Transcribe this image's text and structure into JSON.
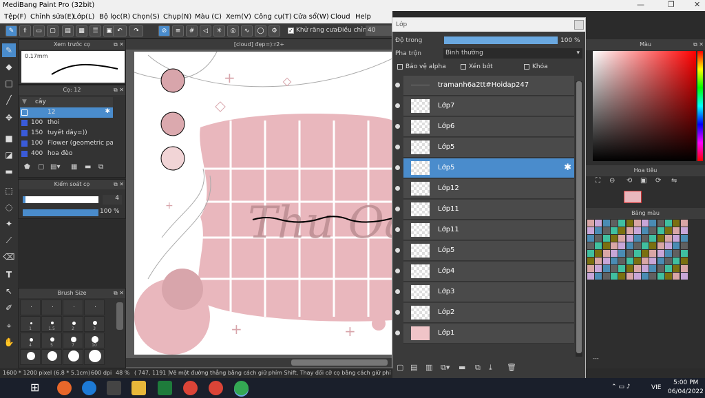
{
  "window": {
    "title": "MediBang Paint Pro (32bit)",
    "minimize": "—",
    "restore": "❐",
    "close": "✕"
  },
  "menu": [
    "Tệp(F)",
    "Chỉnh sửa(E)",
    "Lớp(L)",
    "Bộ lọc(R)",
    "Chọn(S)",
    "Chụp(N)",
    "Màu (C)",
    "Xem(V)",
    "Công cụ(T)",
    "Cửa sổ(W)",
    "Cloud",
    "Help"
  ],
  "toolbar": {
    "antialias_label": "Khử răng cưa",
    "adjust_label": "Điều chỉnh",
    "adjust_value": "40"
  },
  "brush_preview": {
    "title": "Xem trước cọ",
    "size": "0.17mm"
  },
  "brush_panel": {
    "title": "Cọ: 12",
    "group": "cây",
    "items": [
      {
        "size": "12",
        "name": "",
        "selected": true
      },
      {
        "size": "100",
        "name": "thoi"
      },
      {
        "size": "150",
        "name": "tuyết dây=))"
      },
      {
        "size": "100",
        "name": "Flower (geometric patt"
      },
      {
        "size": "400",
        "name": "hoa đèo"
      }
    ]
  },
  "brush_control": {
    "title": "Kiểm soát cọ",
    "size_value": "4",
    "opacity_value": "100 %",
    "opacity_level": 100
  },
  "brush_size": {
    "title": "Brush Size",
    "labels": [
      "1",
      "1.5",
      "2",
      "3",
      "4",
      "5",
      "7",
      "10"
    ]
  },
  "canvas": {
    "tab_title": "[cloud] đẹp=):r2+",
    "art_text": "Thu Oăn"
  },
  "layer_window": {
    "title": "Lớp",
    "opacity_label": "Độ trong",
    "opacity_value": "100 %",
    "opacity_level": 100,
    "blend_label": "Pha trộn",
    "blend_value": "Bình thường",
    "protect_alpha": "Bảo vệ alpha",
    "clipping": "Xén bớt",
    "lock": "Khóa",
    "layers": [
      {
        "name": "tramanh6a2tt#Hoidap247",
        "selected": false
      },
      {
        "name": "Lớp7",
        "selected": false
      },
      {
        "name": "Lớp6",
        "selected": false
      },
      {
        "name": "Lớp5",
        "selected": false
      },
      {
        "name": "Lớp5",
        "selected": true
      },
      {
        "name": "Lớp12",
        "selected": false
      },
      {
        "name": "Lớp11",
        "selected": false
      },
      {
        "name": "Lớp11",
        "selected": false
      },
      {
        "name": "Lớp5",
        "selected": false
      },
      {
        "name": "Lớp4",
        "selected": false
      },
      {
        "name": "Lớp3",
        "selected": false
      },
      {
        "name": "Lớp2",
        "selected": false
      },
      {
        "name": "Lớp1",
        "selected": false
      }
    ]
  },
  "right_panels": {
    "color_title": "Màu",
    "navigator_title": "Hoa tiêu",
    "palette_title": "Bảng màu",
    "palette_footer": "---"
  },
  "status": {
    "dimensions": "1600 * 1200 pixel",
    "size_cm": "(6.8 * 5.1cm)",
    "dpi": "600 dpi",
    "zoom": "48 %",
    "coords": "( 747, 1191 )",
    "hint": "Vẽ một đường thẳng bằng cách giữ phím Shift, Thay đổi cỡ cọ bằng cách giữ phí"
  },
  "taskbar": {
    "language": "VIE",
    "time": "5:00 PM",
    "date": "06/04/2022"
  }
}
